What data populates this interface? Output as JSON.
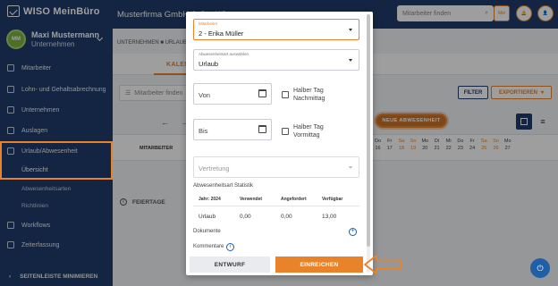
{
  "app": {
    "logo_text": "WISO MeinBüro",
    "company": "Musterfirma GmbH & Co. KG"
  },
  "user": {
    "initials": "MM",
    "name": "Maxi Mustermann",
    "role": "Unternehmen"
  },
  "sidebar": {
    "items": [
      {
        "label": "Mitarbeiter",
        "icon": "people-icon"
      },
      {
        "label": "Lohn- und Gehaltsabrechnung",
        "icon": "payroll-icon"
      },
      {
        "label": "Unternehmen",
        "icon": "building-icon"
      },
      {
        "label": "Auslagen",
        "icon": "receipt-icon"
      },
      {
        "label": "Urlaub/Abwesenheit",
        "icon": "calendar-icon"
      },
      {
        "label": "Übersicht"
      },
      {
        "label": "Abwesenheitsarten"
      },
      {
        "label": "Richtlinien"
      },
      {
        "label": "Workflows",
        "icon": "workflow-icon"
      },
      {
        "label": "Zeiterfassung",
        "icon": "clock-icon"
      }
    ],
    "footer": "SEITENLEISTE MINIMIEREN"
  },
  "topbar": {
    "search_placeholder": "Mitarbeiter finden",
    "badge": "Mei"
  },
  "breadcrumb": "UNTERNEHMEN  ■  URLAUB",
  "tabs": {
    "active": "KALENDER"
  },
  "toolbar": {
    "filter_placeholder": "Mitarbeiter finden",
    "filter_button": "FILTER",
    "export_button": "EXPORTIEREN",
    "new_absence": "NEUE ABWESENHEIT"
  },
  "calendar": {
    "employee_header": "MITARBEITER",
    "days": [
      {
        "n": "16",
        "w": "Do",
        "we": false
      },
      {
        "n": "17",
        "w": "Fr",
        "we": false
      },
      {
        "n": "18",
        "w": "Sa",
        "we": true
      },
      {
        "n": "19",
        "w": "So",
        "we": true
      },
      {
        "n": "20",
        "w": "Mo",
        "we": false
      },
      {
        "n": "21",
        "w": "Di",
        "we": false
      },
      {
        "n": "22",
        "w": "Mi",
        "we": false
      },
      {
        "n": "23",
        "w": "Do",
        "we": false
      },
      {
        "n": "24",
        "w": "Fr",
        "we": false
      },
      {
        "n": "25",
        "w": "Sa",
        "we": true
      },
      {
        "n": "26",
        "w": "So",
        "we": true
      },
      {
        "n": "27",
        "w": "Mo",
        "we": false
      }
    ],
    "holidays_label": "FEIERTAGE"
  },
  "modal": {
    "employee_label": "Mitarbeiter",
    "employee_value": "2 - Erika Müller",
    "absence_type_label": "Abwesenheitsart auswählen",
    "absence_type_value": "Urlaub",
    "von_placeholder": "Von",
    "bis_placeholder": "Bis",
    "halfday_afternoon": "Halber Tag Nachmittag",
    "halfday_morning": "Halber Tag Vormittag",
    "substitute_placeholder": "Vertretung",
    "stats_title": "Abwesenheitsart Statistik",
    "stats_headers": [
      "Jahr: 2024",
      "Verwendet",
      "Angefordert",
      "Verfügbar"
    ],
    "stats_row": [
      "Urlaub",
      "0,00",
      "0,00",
      "13,00"
    ],
    "documents_label": "Dokumente",
    "comments_label": "Kommentare",
    "draft_button": "ENTWURF",
    "submit_button": "EINREICHEN"
  }
}
